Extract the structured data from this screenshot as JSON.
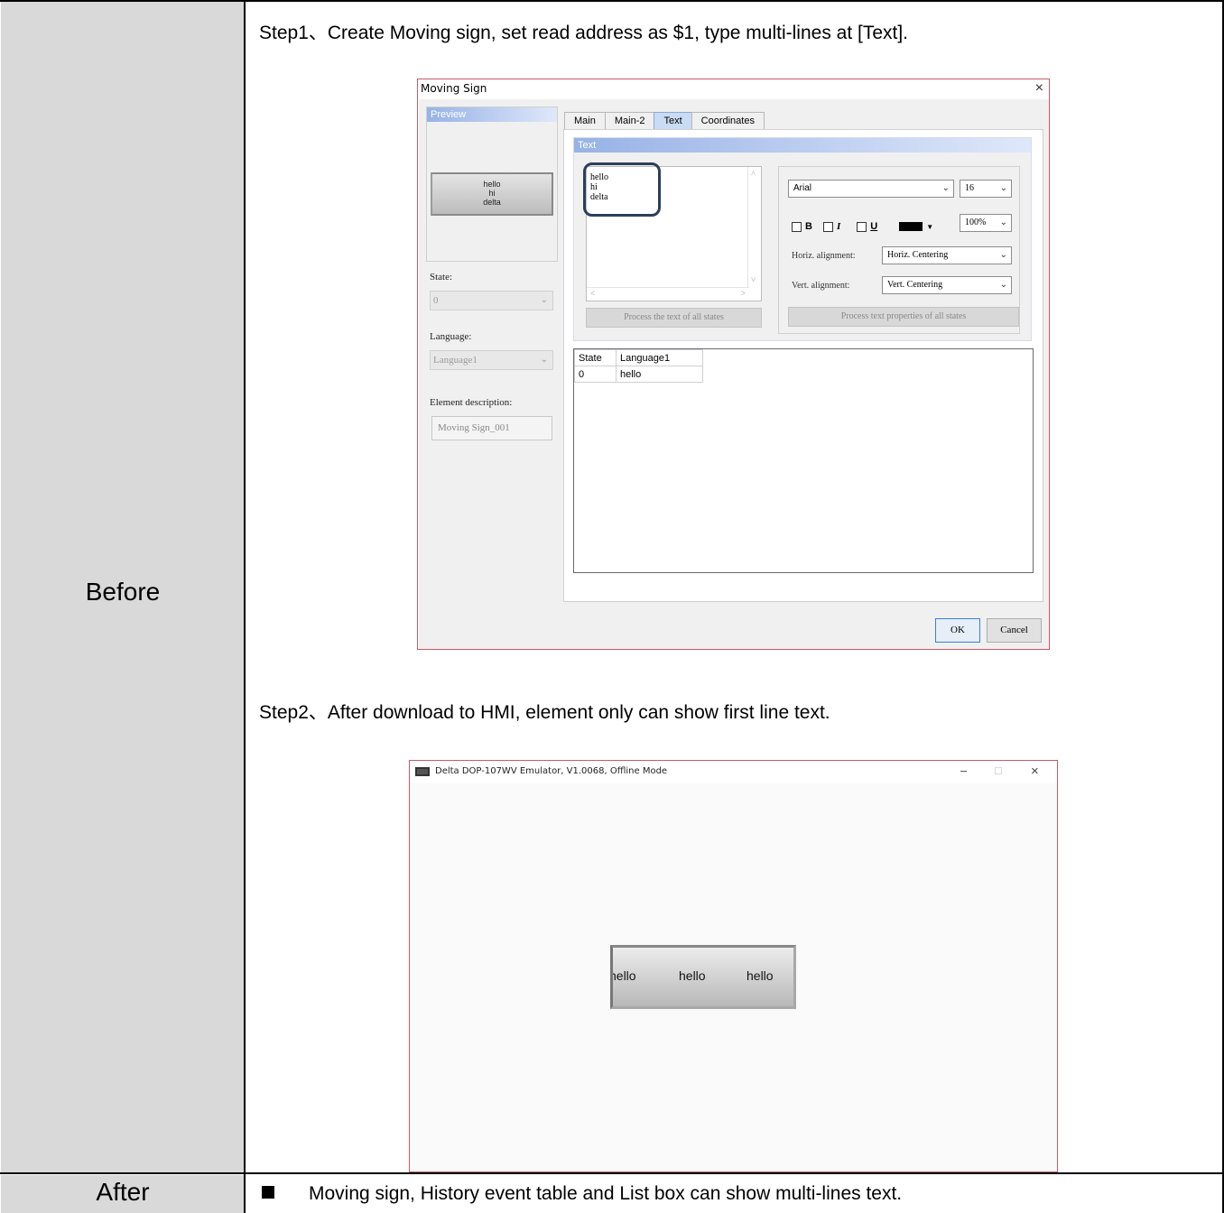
{
  "rows": {
    "before_label": "Before",
    "after_label": "After",
    "after_text": "Moving sign, History event table and List box can show multi-lines text."
  },
  "steps": {
    "step1": "Step1、Create Moving sign, set read address as $1, type multi-lines at [Text].",
    "step2": "Step2、After download to HMI, element only can show first line text."
  },
  "dialog": {
    "title": "Moving Sign",
    "close": "×",
    "preview": {
      "header": "Preview",
      "lines": [
        "hello",
        "hi",
        "delta"
      ]
    },
    "state_label": "State:",
    "state_value": "0",
    "language_label": "Language:",
    "language_value": "Language1",
    "element_desc_label": "Element description:",
    "element_desc_value": "Moving Sign_001",
    "tabs": [
      {
        "label": "Main"
      },
      {
        "label": "Main-2"
      },
      {
        "label": "Text"
      },
      {
        "label": "Coordinates"
      }
    ],
    "active_tab": "Text",
    "text_group_header": "Text",
    "text_lines": [
      "hello",
      "hi",
      "delta"
    ],
    "process_text_button": "Process the text of all states",
    "font": "Arial",
    "font_size": "16",
    "bold_label": "B",
    "italic_label": "I",
    "underline_label": "U",
    "zoom": "100%",
    "horiz_label": "Horiz. alignment:",
    "horiz_value": "Horiz. Centering",
    "vert_label": "Vert. alignment:",
    "vert_value": "Vert. Centering",
    "process_props_button": "Process text properties of all states",
    "grid": {
      "headers": [
        "State",
        "Language1"
      ],
      "rows": [
        [
          "0",
          "hello"
        ]
      ]
    },
    "ok": "OK",
    "cancel": "Cancel"
  },
  "emulator": {
    "title": "Delta DOP-107WV Emulator, V1.0068, Offline Mode",
    "minimize": "–",
    "maximize": "□",
    "close": "×",
    "moving_sign_texts": [
      "hello",
      "hello",
      "hello"
    ]
  }
}
